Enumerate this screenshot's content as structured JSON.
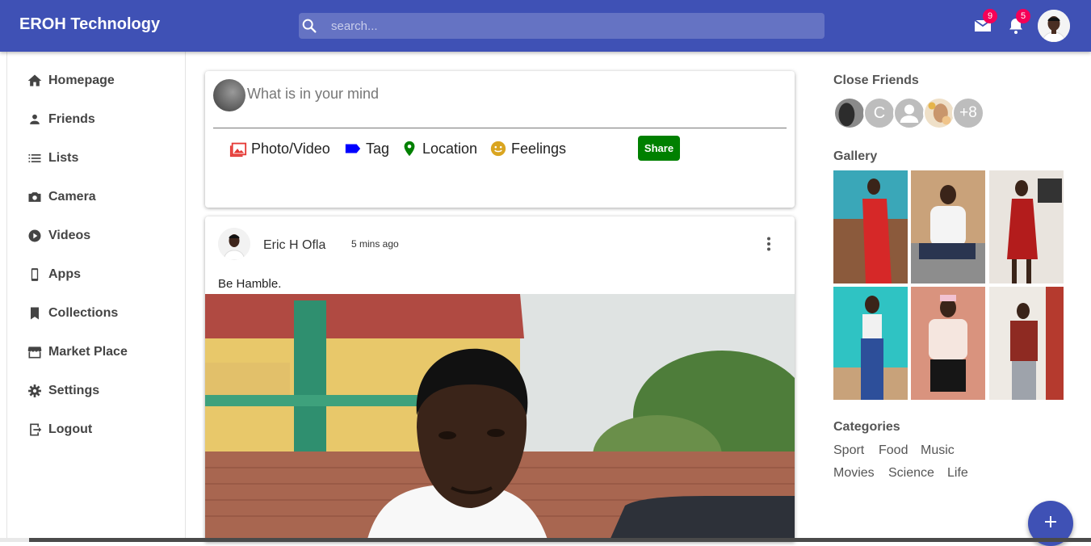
{
  "header": {
    "brand": "EROH Technology",
    "search_placeholder": "search...",
    "mail_count": "9",
    "notification_count": "5"
  },
  "sidebar": {
    "items": [
      {
        "label": "Homepage",
        "icon": "home-icon"
      },
      {
        "label": "Friends",
        "icon": "person-icon"
      },
      {
        "label": "Lists",
        "icon": "list-icon"
      },
      {
        "label": "Camera",
        "icon": "camera-icon"
      },
      {
        "label": "Videos",
        "icon": "play-icon"
      },
      {
        "label": "Apps",
        "icon": "phone-icon"
      },
      {
        "label": "Collections",
        "icon": "bookmark-icon"
      },
      {
        "label": "Market Place",
        "icon": "storefront-icon"
      },
      {
        "label": "Settings",
        "icon": "gear-icon"
      },
      {
        "label": "Logout",
        "icon": "logout-icon"
      }
    ]
  },
  "composer": {
    "placeholder": "What is in your mind",
    "options": [
      {
        "label": "Photo/Video",
        "icon": "photo-icon",
        "color": "#e53935"
      },
      {
        "label": "Tag",
        "icon": "label-icon",
        "color": "#0000ff"
      },
      {
        "label": "Location",
        "icon": "location-pin-icon",
        "color": "#008000"
      },
      {
        "label": "Feelings",
        "icon": "smiley-icon",
        "color": "#daa520"
      }
    ],
    "share_label": "Share"
  },
  "post": {
    "author": "Eric H Ofla",
    "time": "5 mins ago",
    "text": "Be Hamble."
  },
  "right": {
    "close_friends_title": "Close Friends",
    "friends": [
      "photo",
      "C",
      "default-avatar",
      "photo",
      "+8"
    ],
    "gallery_title": "Gallery",
    "categories_title": "Categories",
    "categories": [
      "Sport",
      "Food",
      "Music",
      "Movies",
      "Science",
      "Life"
    ]
  },
  "colors": {
    "primary": "#3f51b5",
    "badge": "#f50057",
    "share": "#008000"
  }
}
